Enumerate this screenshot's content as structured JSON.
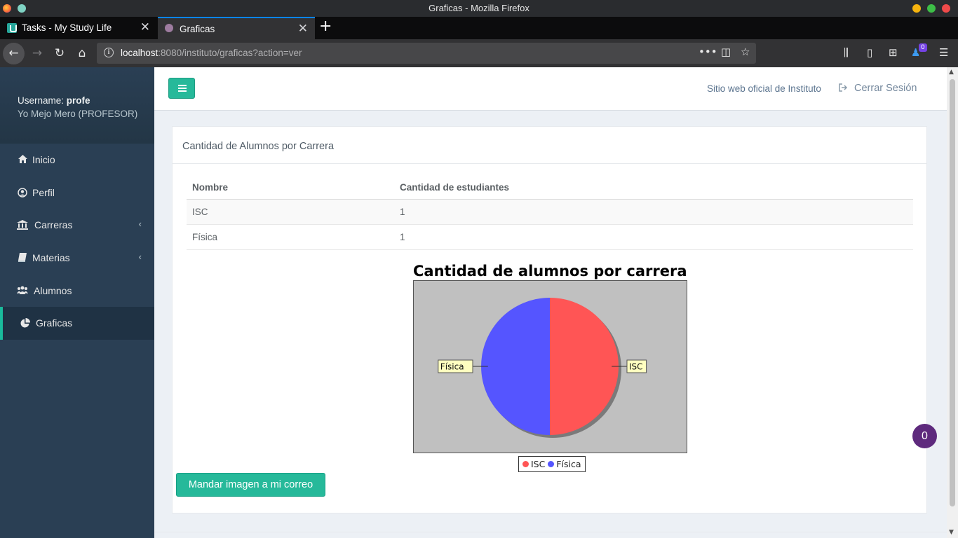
{
  "window": {
    "title": "Graficas - Mozilla Firefox"
  },
  "tabs": [
    {
      "label": "Tasks - My Study Life"
    },
    {
      "label": "Graficas"
    }
  ],
  "urlbar": {
    "host": "localhost",
    "path": ":8080/instituto/graficas?action=ver"
  },
  "toolbar": {
    "badge": "0"
  },
  "sidebar": {
    "username_label": "Username:",
    "username": "profe",
    "role": "Yo Mejo Mero (PROFESOR)",
    "items": [
      {
        "label": "Inicio",
        "icon": "home-icon"
      },
      {
        "label": "Perfil",
        "icon": "user-circle-icon"
      },
      {
        "label": "Carreras",
        "icon": "bank-icon"
      },
      {
        "label": "Materias",
        "icon": "book-icon"
      },
      {
        "label": "Alumnos",
        "icon": "users-icon"
      },
      {
        "label": "Graficas",
        "icon": "pie-chart-icon"
      }
    ]
  },
  "topnav": {
    "site_link": "Sitio web oficial de Instituto",
    "logout": "Cerrar Sesión"
  },
  "panel": {
    "title": "Cantidad de Alumnos por Carrera",
    "table": {
      "headers": [
        "Nombre",
        "Cantidad de estudiantes"
      ],
      "rows": [
        [
          "ISC",
          "1"
        ],
        [
          "Física",
          "1"
        ]
      ]
    },
    "send_button": "Mandar imagen a mi correo"
  },
  "chart_data": {
    "type": "pie",
    "title": "Cantidad de alumnos por carrera",
    "categories": [
      "ISC",
      "Física"
    ],
    "values": [
      1,
      1
    ],
    "colors": [
      "#ff5555",
      "#5555ff"
    ],
    "legend": "bottom"
  },
  "chat_badge": "0"
}
